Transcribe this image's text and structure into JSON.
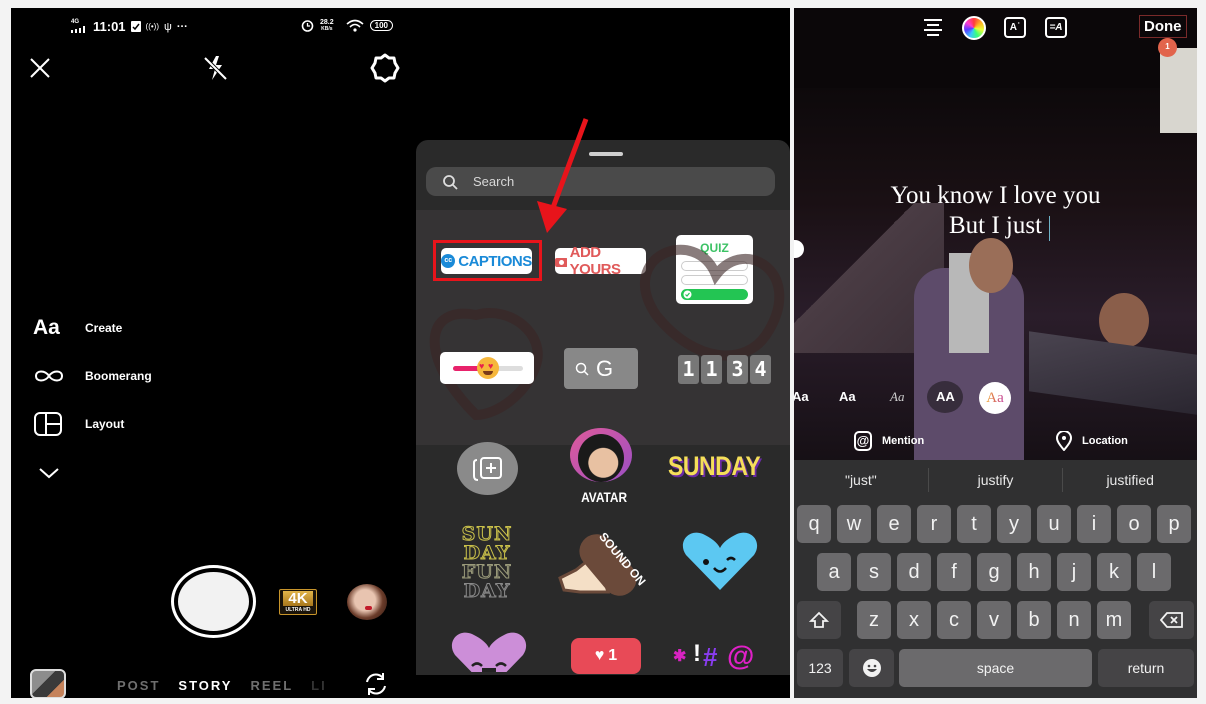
{
  "camera_screen": {
    "status_bar": {
      "network": "4G",
      "time": "11:01",
      "more": "···",
      "data_speed_value": "28.2",
      "data_speed_unit": "KB/s",
      "battery": "100"
    },
    "top_icons": [
      "close-icon",
      "flash-off-icon",
      "settings-gear-icon"
    ],
    "tools": [
      {
        "icon": "Aa",
        "label": "Create"
      },
      {
        "icon": "infinity-icon",
        "label": "Boomerang"
      },
      {
        "icon": "layout-icon",
        "label": "Layout"
      }
    ],
    "quality_badge": "4K",
    "quality_sub": "ULTRA HD",
    "modes": [
      {
        "label": "POST",
        "active": false
      },
      {
        "label": "STORY",
        "active": true
      },
      {
        "label": "REEL",
        "active": false
      },
      {
        "label": "LI",
        "active": false
      }
    ]
  },
  "sticker_tray": {
    "search_placeholder": "Search",
    "stickers": {
      "captions": "CAPTIONS",
      "captions_icon": "cc",
      "add_yours": "ADD YOURS",
      "quiz": "QUIZ",
      "gif_search": "G",
      "countdown_digits": [
        "1",
        "1",
        "3",
        "4"
      ],
      "avatar": "AVATAR",
      "sunday": "SUNDAY",
      "sunday_funday": [
        "SUN",
        "DAY",
        "FUN",
        "DAY"
      ],
      "sound_on": "SOUND ON",
      "like_count": "1"
    },
    "highlight_color": "#e8141b"
  },
  "text_editor": {
    "toolbar_icons": [
      "align-center-icon",
      "color-wheel-icon",
      "text-effects-icon",
      "text-animate-icon"
    ],
    "done_label": "Done",
    "done_badge": "1",
    "lyrics_lines": [
      "You know I love you",
      "But I just"
    ],
    "font_options": [
      "Aa",
      "Aa",
      "Aa",
      "AA",
      "Aa"
    ],
    "selected_font_index": 4,
    "mention_label": "Mention",
    "location_label": "Location",
    "keyboard": {
      "suggestions": [
        "\"just\"",
        "justify",
        "justified"
      ],
      "row1": [
        "q",
        "w",
        "e",
        "r",
        "t",
        "y",
        "u",
        "i",
        "o",
        "p"
      ],
      "row2": [
        "a",
        "s",
        "d",
        "f",
        "g",
        "h",
        "j",
        "k",
        "l"
      ],
      "row3": [
        "z",
        "x",
        "c",
        "v",
        "b",
        "n",
        "m"
      ],
      "numbers_key": "123",
      "space_key": "space",
      "return_key": "return"
    }
  }
}
